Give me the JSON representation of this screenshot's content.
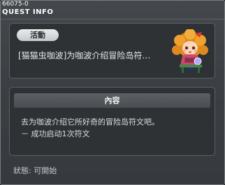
{
  "quest": {
    "id": "66075-0",
    "window_title": "QUEST INFO",
    "category_badge": "活動",
    "name": "[猫猫虫咖波]为咖波介绍冒险岛符…",
    "content_header": "內容",
    "description": "去为咖波介绍它所好奇的冒险岛符文吧。",
    "task": "－ 成功启动1次符文",
    "status": "狀態:  可開始"
  },
  "icons": {
    "npc": "npc-portrait-icon"
  },
  "colors": {
    "panel": "#2f3235",
    "window_bg": "#3c4044",
    "badge": "#d8dadc",
    "text": "#e8e8e8"
  }
}
